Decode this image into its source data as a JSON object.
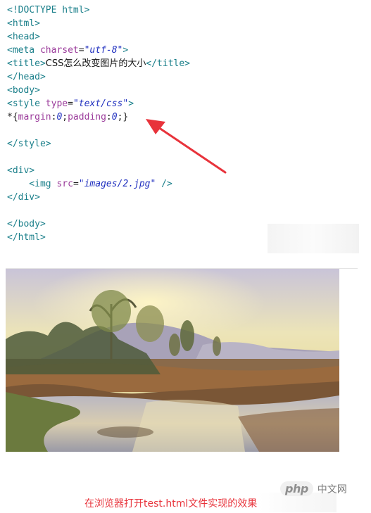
{
  "code_lines": {
    "l1_tag": "<!DOCTYPE html>",
    "l2_tag": "<html>",
    "l3_tag": "<head>",
    "l4_open": "<meta",
    "l4_attr": "charset",
    "l4_eq": "=",
    "l4_val": "\"utf-8\"",
    "l4_close": ">",
    "l5_open": "<title>",
    "l5_text": "CSS怎么改变图片的大小",
    "l5_close": "</title>",
    "l6_tag": "</head>",
    "l7_tag": "<body>",
    "l8_open": "<style",
    "l8_attr": "type",
    "l8_eq": "=",
    "l8_val": "\"text/css\"",
    "l8_close": ">",
    "l9_star": "*{",
    "l9_prop1": "margin",
    "l9_colon1": ":",
    "l9_val1": "0",
    "l9_semi1": ";",
    "l9_prop2": "padding",
    "l9_colon2": ":",
    "l9_val2": "0",
    "l9_end": ";}",
    "l11_tag": "</style>",
    "l13_tag": "<div>",
    "l14_open": "    <img",
    "l14_attr": "src",
    "l14_eq": "=",
    "l14_val": "\"images/2.jpg\"",
    "l14_close": " />",
    "l15_tag": "</div>",
    "l17_tag": "</body>",
    "l18_tag": "</html>"
  },
  "caption": {
    "text": "在浏览器打开test.html文件实现的效果"
  },
  "watermark": {
    "php": "php",
    "cn": "中文网"
  },
  "colors": {
    "tag": "#1a7f8a",
    "attr": "#9b3c9b",
    "string": "#1f2fbf",
    "arrow": "#e8333b",
    "caption": "#e8333b"
  }
}
